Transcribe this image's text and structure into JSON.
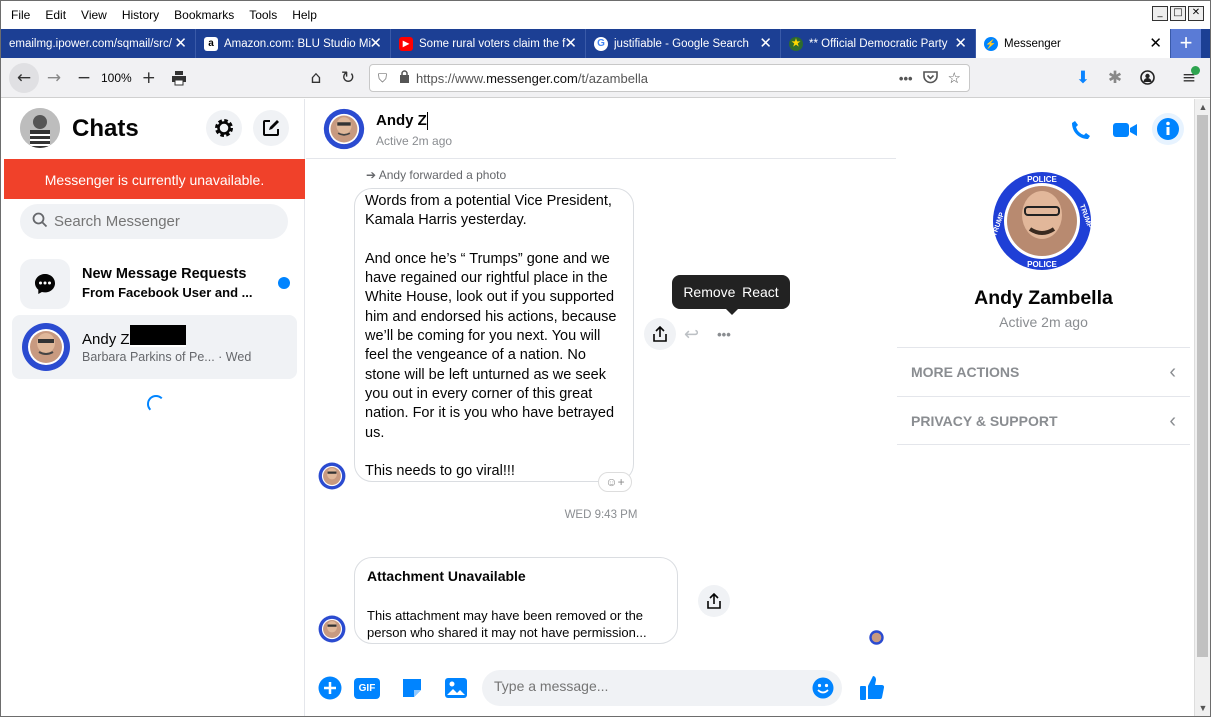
{
  "menu": [
    "File",
    "Edit",
    "View",
    "History",
    "Bookmarks",
    "Tools",
    "Help"
  ],
  "tabs": [
    {
      "label": "emailmg.ipower.com/sqmail/src/",
      "icon": "none",
      "active": false
    },
    {
      "label": "Amazon.com: BLU Studio Mi",
      "icon": "amazon-icon",
      "active": false
    },
    {
      "label": "Some rural voters claim the f",
      "icon": "youtube-icon",
      "active": false
    },
    {
      "label": "justifiable - Google Search",
      "icon": "google-icon",
      "active": false
    },
    {
      "label": "** Official Democratic Party",
      "icon": "party-icon",
      "active": false
    },
    {
      "label": "Messenger",
      "icon": "messenger-icon",
      "active": true
    }
  ],
  "nav": {
    "zoom": "100%",
    "url_prefix": "https://www.",
    "url_host": "messenger.com",
    "url_path": "/t/azambella"
  },
  "left": {
    "title": "Chats",
    "banner": "Messenger is currently unavailable.",
    "search_placeholder": "Search Messenger",
    "requests_title": "New Message Requests",
    "requests_sub": "From Facebook User and ...",
    "chat_name": "Andy Z",
    "chat_snippet": "Barbara Parkins  of Pe...",
    "chat_time": " · Wed"
  },
  "conversation": {
    "name": "Andy Z",
    "status": "Active 2m ago",
    "forwarded_note": "Andy forwarded a photo",
    "message_paragraphs": [
      "Words from a potential Vice President, Kamala Harris yesterday.",
      "And once he’s “ Trumps” gone and we have regained our rightful place in the White House, look out if you supported him and endorsed his actions, because we’ll be coming for you next. You will feel the vengeance of a nation. No stone will be left unturned as we seek you out in every corner of this great nation. For it is you who have betrayed us.",
      "This needs to go viral!!!"
    ],
    "tooltip": {
      "remove": "Remove",
      "react": "React"
    },
    "timestamp": "WED 9:43 PM",
    "attachment_title": "Attachment Unavailable",
    "attachment_line1": "This attachment may have been removed or the",
    "attachment_line2": "person who shared it may not have permission...",
    "composer_placeholder": "Type a message...",
    "gif_label": "GIF"
  },
  "profile": {
    "name": "Andy Zambella",
    "status": "Active 2m ago",
    "badge_top": "POLICE",
    "badge_left": "TRUMP",
    "badge_right": "TRUMP",
    "badge_bottom": "POLICE",
    "sections": [
      "MORE ACTIONS",
      "PRIVACY & SUPPORT"
    ]
  },
  "colors": {
    "brand": "#0084ff",
    "banner": "#f0412a",
    "tabbar": "#1c3f94"
  }
}
